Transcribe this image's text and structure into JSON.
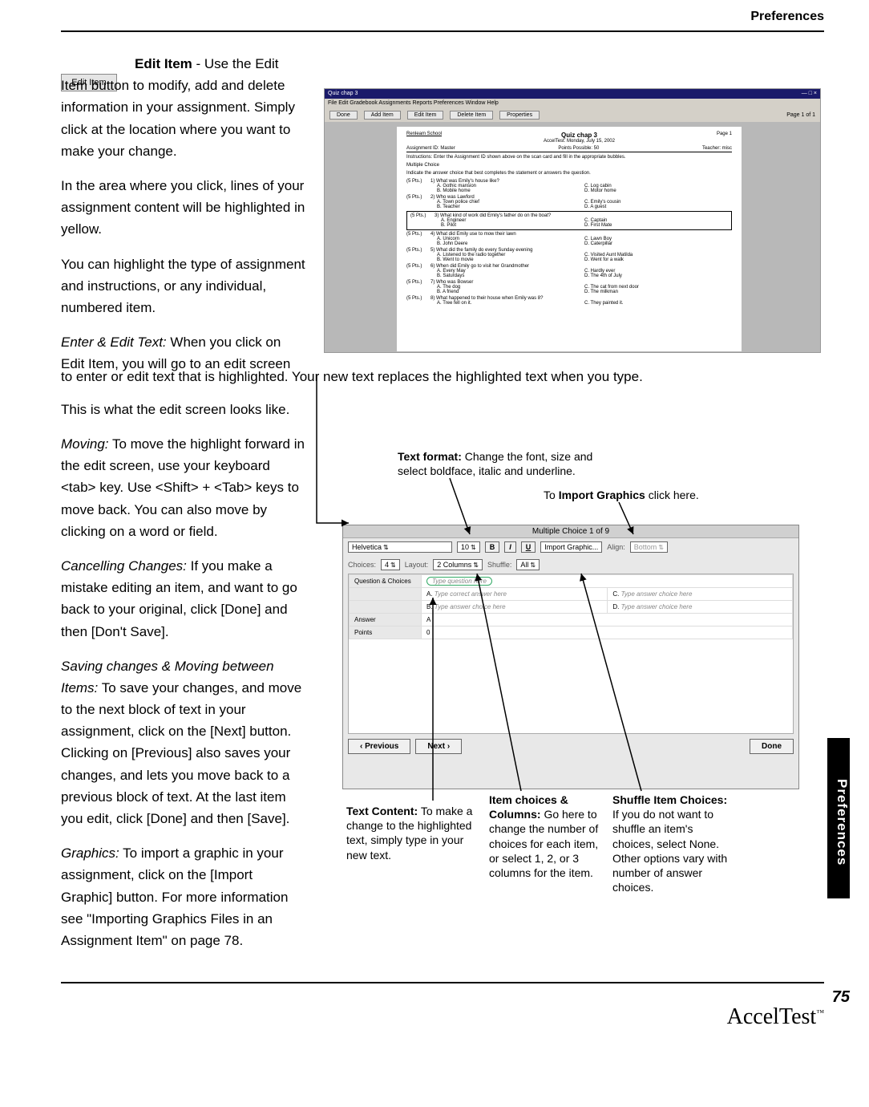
{
  "header": {
    "section": "Preferences"
  },
  "editItemButton": "Edit Item",
  "body": {
    "p1a": "Edit Item",
    "p1b": " - Use the Edit Item button to modify, add and delete information in your assignment. Simply click at the location where you want to make your change.",
    "p2": "In the area where you click, lines of your assignment content will be highlighted in yellow.",
    "p3": "You can highlight the type of assignment and instructions, or any individual, numbered item.",
    "p4a": "Enter & Edit Text:",
    "p4b": " When you click on Edit Item, you will go to an edit screen to enter or edit text that is highlighted. Your new text replaces the highlighted text when you type.",
    "p5": " This is what the edit screen looks like.",
    "p6a": "Moving:",
    "p6b": " To move the highlight forward in the edit screen, use your keyboard <tab> key. Use <Shift> + <Tab> keys to move back. You can also move by clicking on a word or field.",
    "p7a": "Cancelling Changes:",
    "p7b": " If you make a mistake editing an item, and want to go back to your original, click [Done] and then [Don't Save].",
    "p8a": "Saving changes & Moving between Items:",
    "p8b": " To save your changes, and move to the next block of text in your assignment, click on the [Next] button. Clicking on [Previous] also saves your changes, and lets you move back to a previous block of text. At the last item you edit, click [Done] and then [Save].",
    "p9a": "Graphics:",
    "p9b": " To import a graphic in your assignment, click on the [Import Graphic] button. For more information see \"Importing Graphics Files in an Assignment Item\" on page 78."
  },
  "ss1": {
    "title": "Quiz chap 3",
    "menubar": "File   Edit   Gradebook   Assignments   Reports   Preferences   Window   Help",
    "buttons": {
      "done": "Done",
      "add": "Add Item",
      "edit": "Edit Item",
      "delete": "Delete Item",
      "props": "Properties",
      "page": "Page 1 of 1"
    },
    "page": {
      "title": "Quiz chap 3",
      "sub": "AccelTest: Monday, July 15, 2002",
      "school": "Renleam School",
      "pageno": "Page 1",
      "assign": "Assignment ID: Master",
      "points": "Points Possible: 50",
      "teacher": "Teacher: misc",
      "instr": "Instructions: Enter the Assignment ID shown above on the scan card and fill in the appropriate bubbles.",
      "section": "Multiple Choice",
      "direction": "Indicate the answer choice that best completes the statement or answers the question.",
      "pts": "(5 Pts.)",
      "questions": [
        {
          "n": "1)",
          "q": "What was Emily's house like?",
          "a": "A.  Gothic mansion",
          "b": "B.  Mobile home",
          "c": "C.  Log cabin",
          "d": "D.  Motor home"
        },
        {
          "n": "2)",
          "q": "Who was Lawford",
          "a": "A.  Town police chief",
          "b": "B.  Teacher",
          "c": "C.  Emily's cousin",
          "d": "D.  A guest"
        },
        {
          "n": "3)",
          "q": "What kind of work did Emily's father do on the boat?",
          "a": "A.  Engineer",
          "b": "B.  Pilot",
          "c": "C.  Captain",
          "d": "D.  First Mate"
        },
        {
          "n": "4)",
          "q": "What did Emily use to mow their lawn",
          "a": "A.  Unicorn",
          "b": "B.  John Deere",
          "c": "C.  Lawn Boy",
          "d": "D.  Caterpillar"
        },
        {
          "n": "5)",
          "q": "What did the family do every Sunday evening",
          "a": "A.  Listened to the radio together",
          "b": "B.  Went to movie",
          "c": "C.  Visited Aunt Matilda",
          "d": "D.  Went for a walk"
        },
        {
          "n": "6)",
          "q": "When did Emily go to visit her Grandmother",
          "a": "A.  Every May",
          "b": "B.  Saturdays",
          "c": "C.  Hardly ever",
          "d": "D.  The 4th of July"
        },
        {
          "n": "7)",
          "q": "Who was Bowser",
          "a": "A.  The dog",
          "b": "B.  A friend",
          "c": "C.  The cat from next door",
          "d": "D.  The milkman"
        },
        {
          "n": "8)",
          "q": "What happened to their house when Emily was 8?",
          "a": "A.  Tree fell on it.",
          "b": "",
          "c": "C.  They painted it.",
          "d": ""
        }
      ]
    }
  },
  "callouts": {
    "textFormat": {
      "bold": "Text format:",
      "rest": " Change the font, size and select boldface, italic and underline."
    },
    "importGraphics": {
      "pre": "To ",
      "bold": "Import Graphics",
      "rest": " click here."
    },
    "textContent": {
      "bold": "Text Content:",
      "rest": " To make a change to the highlighted text, simply type in your new text."
    },
    "itemChoices": {
      "bold": "Item choices & Columns:",
      "rest": " Go here to change the number of choices for each item, or select 1, 2, or 3 columns for the item."
    },
    "shuffle": {
      "bold": "Shuffle Item Choices:",
      "rest": " If you do not want to shuffle an item's choices, select None. Other options vary with number of answer choices."
    }
  },
  "ss2": {
    "title": "Multiple Choice  1 of 9",
    "font": "Helvetica",
    "size": "10",
    "btnB": "B",
    "btnI": "I",
    "btnU": "U",
    "import": "Import Graphic...",
    "alignLabel": "Align:",
    "alignVal": "Bottom",
    "choicesLabel": "Choices:",
    "choicesVal": "4",
    "layoutLabel": "Layout:",
    "layoutVal": "2 Columns",
    "shuffleLabel": "Shuffle:",
    "shuffleVal": "All",
    "tab": "Question & Choices",
    "qPlaceholder": "Type question here",
    "optA": "A.",
    "optAtext": "Type correct answer here",
    "optB": "B.",
    "optBtext": "Type answer choice here",
    "optC": "C.",
    "optCtext": "Type answer choice here",
    "optD": "D.",
    "optDtext": "Type answer choice here",
    "ansLabel": "Answer",
    "ansVal": "A",
    "ptsLabel": "Points",
    "ptsVal": "0",
    "prev": "‹ Previous",
    "next": "Next ›",
    "done": "Done"
  },
  "sideTab": "Preferences",
  "pageNum": "75",
  "logo": "AccelTest",
  "logoTM": "™"
}
